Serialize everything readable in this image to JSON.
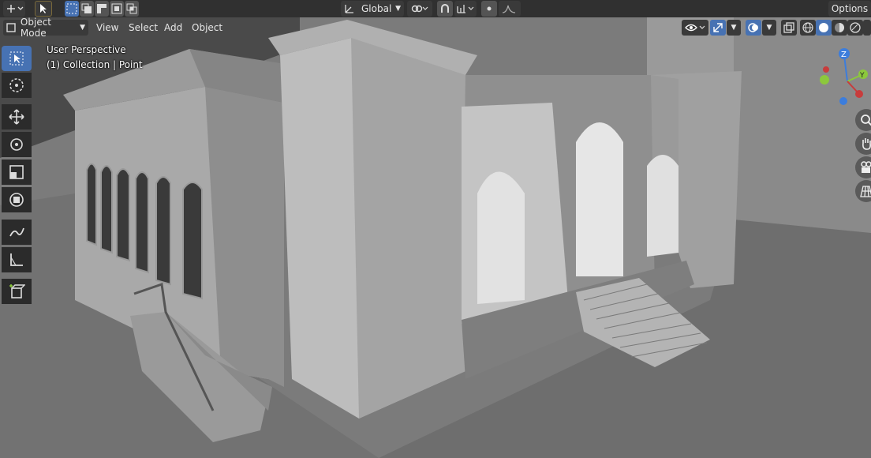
{
  "topbar": {
    "transform_orientation": "Global",
    "options_label": "Options"
  },
  "header": {
    "mode_label": "Object Mode",
    "menus": [
      "View",
      "Select",
      "Add",
      "Object"
    ]
  },
  "viewport": {
    "perspective_label": "User Perspective",
    "collection_label": "(1) Collection | Point"
  },
  "gizmo": {
    "axis_z": "Z",
    "axis_y": "Y",
    "colors": {
      "x": "#c83c3c",
      "y": "#8cc83c",
      "z": "#3c7ddc"
    }
  },
  "toolbar_icons": [
    "select-box-icon",
    "cursor-icon",
    "move-icon",
    "rotate-icon",
    "scale-icon",
    "transform-icon",
    "annotate-icon",
    "measure-icon",
    "add-cube-icon"
  ],
  "colors": {
    "accent": "#4772b3",
    "header_bg": "#303030"
  }
}
